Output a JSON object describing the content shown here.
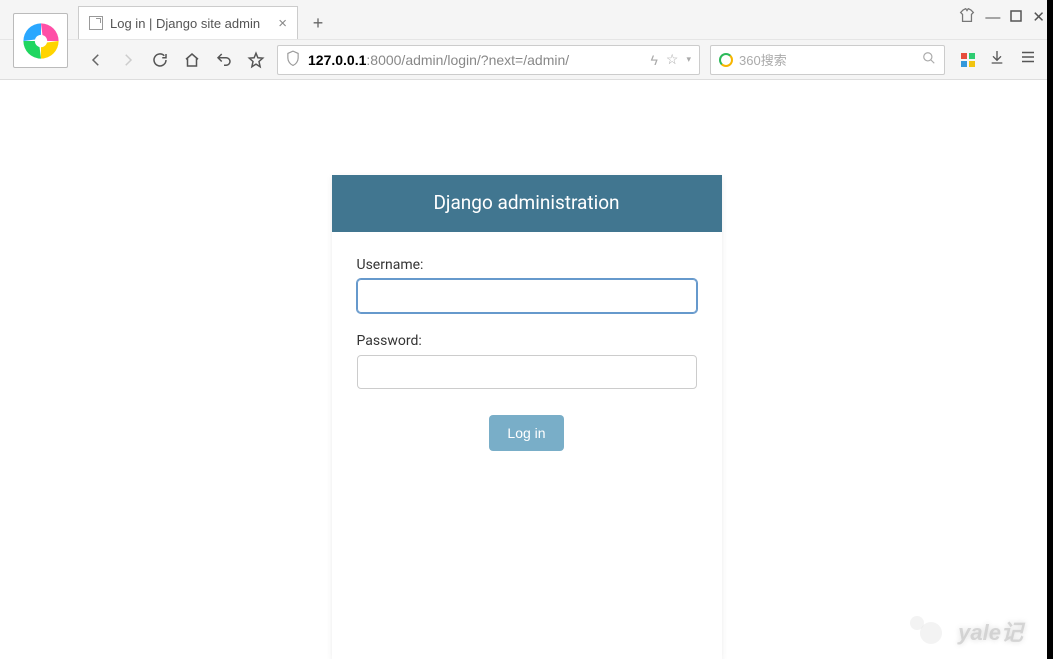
{
  "browser": {
    "tab": {
      "title": "Log in | Django site admin"
    },
    "url_host": "127.0.0.1",
    "url_rest": ":8000/admin/login/?next=/admin/",
    "search_placeholder": "360搜索"
  },
  "login": {
    "header": "Django administration",
    "username_label": "Username:",
    "username_value": "",
    "password_label": "Password:",
    "password_value": "",
    "submit_label": "Log in"
  },
  "watermark": {
    "text": "yale记"
  }
}
